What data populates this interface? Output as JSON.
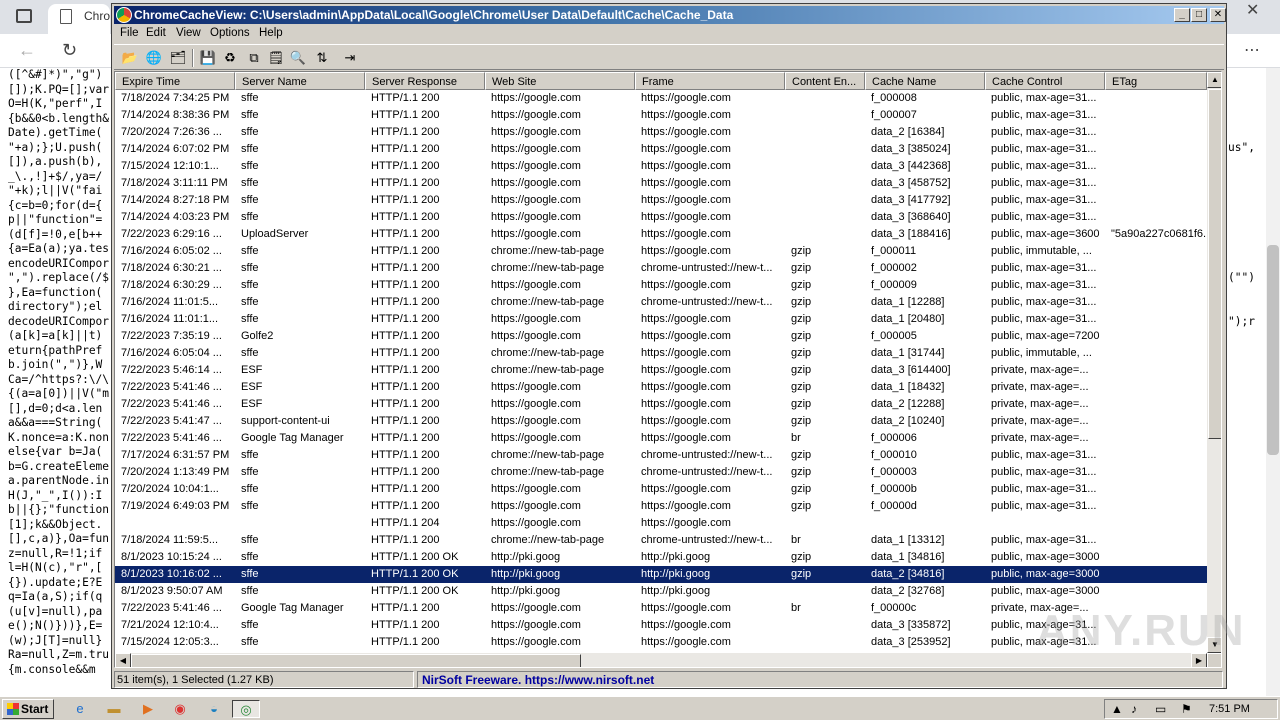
{
  "background_browser": {
    "tab_title": "Chro",
    "code_lines": [
      "([^&#]*)\",\"g\")",
      "[]);K.PQ=[];var",
      "O=H(K,\"perf\",I",
      "{b&&0<b.length&",
      "Date).getTime(",
      "\"+a);};U.push(",
      "[]),a.push(b),",
      "_\\.,!]+$/,ya=/",
      "\"+k);l||V(\"fai",
      "{c=b=0;for(d={",
      "p||\"function\"=",
      "(d[f]=!0,e[b++",
      "{a=Ea(a);ya.tes",
      "encodeURICompor",
      "\",\").replace(/$",
      "},Ea=function(",
      "directory\");el",
      "decodeURICompor",
      "(a[k]=a[k]||t)",
      "eturn{pathPref",
      "b.join(\",\")},W",
      "Ca=/^https?:\\/\\",
      "{(a=a[0])||V(\"m",
      "[],d=0;d<a.len",
      "a&&a===String(",
      "K.nonce=a:K.non",
      "else{var b=Ja(",
      "b=G.createEleme",
      "a.parentNode.in",
      "H(J,\"_\",I()):I",
      "b||{};\"function",
      "[1];k&&Object.",
      "[],c,a)},Oa=fun",
      "z=null,R=!1;if",
      "l=H(N(c),\"r\",[",
      "{}).update;E?E",
      "q=Ia(a,S);if(q",
      "(u[v]=null),pa",
      "e();N()}))},E=",
      "(w);J[T]=null}",
      "Ra=null,Z=m.tru",
      "{m.console&&m"
    ],
    "right_code": [
      "",
      "",
      "",
      "",
      "",
      "us\",",
      "",
      "",
      "",
      "",
      "",
      "",
      "",
      "",
      "(\"\")",
      "",
      "",
      "\");r"
    ]
  },
  "window": {
    "title": "ChromeCacheView:  C:\\Users\\admin\\AppData\\Local\\Google\\Chrome\\User Data\\Default\\Cache\\Cache_Data",
    "menu": [
      "File",
      "Edit",
      "View",
      "Options",
      "Help"
    ],
    "toolbar_icons": [
      "open-folder-icon",
      "globe-icon",
      "copy-files-icon",
      "save-icon",
      "refresh-icon",
      "copy-icon",
      "properties-icon",
      "find-icon",
      "sort-icon",
      "exit-icon"
    ]
  },
  "columns": [
    "Expire Time",
    "Server Name",
    "Server Response",
    "Web Site",
    "Frame",
    "Content En...",
    "Cache Name",
    "Cache Control",
    "ETag"
  ],
  "rows": [
    [
      "7/18/2024 7:34:25 PM",
      "sffe",
      "HTTP/1.1 200",
      "https://google.com",
      "https://google.com",
      "",
      "f_000008",
      "public, max-age=31...",
      ""
    ],
    [
      "7/14/2024 8:38:36 PM",
      "sffe",
      "HTTP/1.1 200",
      "https://google.com",
      "https://google.com",
      "",
      "f_000007",
      "public, max-age=31...",
      ""
    ],
    [
      "7/20/2024 7:26:36 ...",
      "sffe",
      "HTTP/1.1 200",
      "https://google.com",
      "https://google.com",
      "",
      "data_2  [16384]",
      "public, max-age=31...",
      ""
    ],
    [
      "7/14/2024 6:07:02 PM",
      "sffe",
      "HTTP/1.1 200",
      "https://google.com",
      "https://google.com",
      "",
      "data_3  [385024]",
      "public, max-age=31...",
      ""
    ],
    [
      "7/15/2024 12:10:1...",
      "sffe",
      "HTTP/1.1 200",
      "https://google.com",
      "https://google.com",
      "",
      "data_3  [442368]",
      "public, max-age=31...",
      ""
    ],
    [
      "7/18/2024 3:11:11 PM",
      "sffe",
      "HTTP/1.1 200",
      "https://google.com",
      "https://google.com",
      "",
      "data_3  [458752]",
      "public, max-age=31...",
      ""
    ],
    [
      "7/14/2024 8:27:18 PM",
      "sffe",
      "HTTP/1.1 200",
      "https://google.com",
      "https://google.com",
      "",
      "data_3  [417792]",
      "public, max-age=31...",
      ""
    ],
    [
      "7/14/2024 4:03:23 PM",
      "sffe",
      "HTTP/1.1 200",
      "https://google.com",
      "https://google.com",
      "",
      "data_3  [368640]",
      "public, max-age=31...",
      ""
    ],
    [
      "7/22/2023 6:29:16 ...",
      "UploadServer",
      "HTTP/1.1 200",
      "https://google.com",
      "https://google.com",
      "",
      "data_3  [188416]",
      "public, max-age=3600",
      "\"5a90a227c0681f6..."
    ],
    [
      "7/16/2024 6:05:02 ...",
      "sffe",
      "HTTP/1.1 200",
      "chrome://new-tab-page",
      "https://google.com",
      "gzip",
      "f_000011",
      "public, immutable, ...",
      ""
    ],
    [
      "7/18/2024 6:30:21 ...",
      "sffe",
      "HTTP/1.1 200",
      "chrome://new-tab-page",
      "chrome-untrusted://new-t...",
      "gzip",
      "f_000002",
      "public, max-age=31...",
      ""
    ],
    [
      "7/18/2024 6:30:29 ...",
      "sffe",
      "HTTP/1.1 200",
      "https://google.com",
      "https://google.com",
      "gzip",
      "f_000009",
      "public, max-age=31...",
      ""
    ],
    [
      "7/16/2024 11:01:5...",
      "sffe",
      "HTTP/1.1 200",
      "chrome://new-tab-page",
      "chrome-untrusted://new-t...",
      "gzip",
      "data_1  [12288]",
      "public, max-age=31...",
      ""
    ],
    [
      "7/16/2024 11:01:1...",
      "sffe",
      "HTTP/1.1 200",
      "https://google.com",
      "https://google.com",
      "gzip",
      "data_1  [20480]",
      "public, max-age=31...",
      ""
    ],
    [
      "7/22/2023 7:35:19 ...",
      "Golfe2",
      "HTTP/1.1 200",
      "https://google.com",
      "https://google.com",
      "gzip",
      "f_000005",
      "public, max-age=7200",
      ""
    ],
    [
      "7/16/2024 6:05:04 ...",
      "sffe",
      "HTTP/1.1 200",
      "chrome://new-tab-page",
      "https://google.com",
      "gzip",
      "data_1  [31744]",
      "public, immutable, ...",
      ""
    ],
    [
      "7/22/2023 5:46:14 ...",
      "ESF",
      "HTTP/1.1 200",
      "chrome://new-tab-page",
      "https://google.com",
      "gzip",
      "data_3  [614400]",
      "private, max-age=...",
      ""
    ],
    [
      "7/22/2023 5:41:46 ...",
      "ESF",
      "HTTP/1.1 200",
      "https://google.com",
      "https://google.com",
      "gzip",
      "data_1  [18432]",
      "private, max-age=...",
      ""
    ],
    [
      "7/22/2023 5:41:46 ...",
      "ESF",
      "HTTP/1.1 200",
      "https://google.com",
      "https://google.com",
      "gzip",
      "data_2  [12288]",
      "private, max-age=...",
      ""
    ],
    [
      "7/22/2023 5:41:47 ...",
      "support-content-ui",
      "HTTP/1.1 200",
      "https://google.com",
      "https://google.com",
      "gzip",
      "data_2  [10240]",
      "private, max-age=...",
      ""
    ],
    [
      "7/22/2023 5:41:46 ...",
      "Google Tag Manager",
      "HTTP/1.1 200",
      "https://google.com",
      "https://google.com",
      "br",
      "f_000006",
      "private, max-age=...",
      ""
    ],
    [
      "7/17/2024 6:31:57 PM",
      "sffe",
      "HTTP/1.1 200",
      "chrome://new-tab-page",
      "chrome-untrusted://new-t...",
      "gzip",
      "f_000010",
      "public, max-age=31...",
      ""
    ],
    [
      "7/20/2024 1:13:49 PM",
      "sffe",
      "HTTP/1.1 200",
      "chrome://new-tab-page",
      "chrome-untrusted://new-t...",
      "gzip",
      "f_000003",
      "public, max-age=31...",
      ""
    ],
    [
      "7/20/2024 10:04:1...",
      "sffe",
      "HTTP/1.1 200",
      "https://google.com",
      "https://google.com",
      "gzip",
      "f_00000b",
      "public, max-age=31...",
      ""
    ],
    [
      "7/19/2024 6:49:03 PM",
      "sffe",
      "HTTP/1.1 200",
      "https://google.com",
      "https://google.com",
      "gzip",
      "f_00000d",
      "public, max-age=31...",
      ""
    ],
    [
      "",
      "",
      "HTTP/1.1 204",
      "https://google.com",
      "https://google.com",
      "",
      "",
      "",
      ""
    ],
    [
      "7/18/2024 11:59:5...",
      "sffe",
      "HTTP/1.1 200",
      "chrome://new-tab-page",
      "chrome-untrusted://new-t...",
      "br",
      "data_1  [13312]",
      "public, max-age=31...",
      ""
    ],
    [
      "8/1/2023 10:15:24 ...",
      "sffe",
      "HTTP/1.1 200 OK",
      "http://pki.goog",
      "http://pki.goog",
      "gzip",
      "data_1  [34816]",
      "public, max-age=3000",
      ""
    ],
    [
      "8/1/2023 10:16:02 ...",
      "sffe",
      "HTTP/1.1 200 OK",
      "http://pki.goog",
      "http://pki.goog",
      "gzip",
      "data_2  [34816]",
      "public, max-age=3000",
      ""
    ],
    [
      "8/1/2023 9:50:07 AM",
      "sffe",
      "HTTP/1.1 200 OK",
      "http://pki.goog",
      "http://pki.goog",
      "",
      "data_2  [32768]",
      "public, max-age=3000",
      ""
    ],
    [
      "7/22/2023 5:41:46 ...",
      "Google Tag Manager",
      "HTTP/1.1 200",
      "https://google.com",
      "https://google.com",
      "br",
      "f_00000c",
      "private, max-age=...",
      ""
    ],
    [
      "7/21/2024 12:10:4...",
      "sffe",
      "HTTP/1.1 200",
      "https://google.com",
      "https://google.com",
      "",
      "data_3  [335872]",
      "public, max-age=31...",
      ""
    ],
    [
      "7/15/2024 12:05:3...",
      "sffe",
      "HTTP/1.1 200",
      "https://google.com",
      "https://google.com",
      "",
      "data_3  [253952]",
      "public, max-age=31...",
      ""
    ]
  ],
  "selected_row": 28,
  "status": {
    "count": "51 item(s), 1 Selected  (1.27 KB)",
    "link": "NirSoft Freeware.  https://www.nirsoft.net"
  },
  "taskbar": {
    "start_label": "Start",
    "clock": "7:51 PM"
  },
  "watermark": "ANY.RUN"
}
